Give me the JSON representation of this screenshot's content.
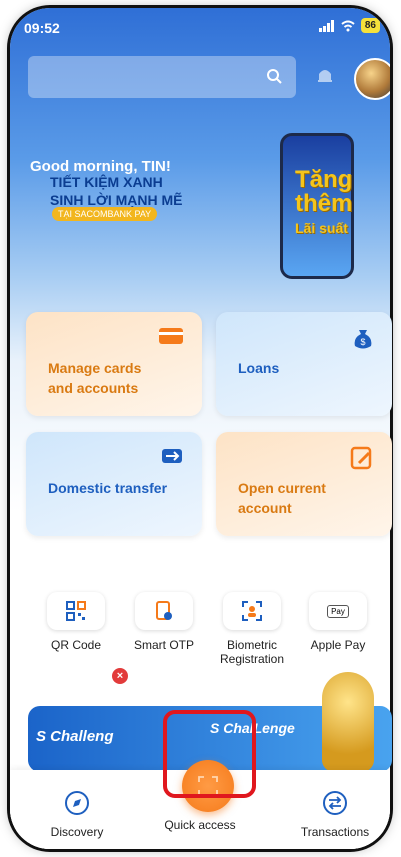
{
  "status": {
    "time": "09:52",
    "battery": "86"
  },
  "greeting": "Good morning, TIN!",
  "promo": {
    "line1": "TIẾT KIỆM XANH",
    "line2": "SINH LỜI MẠNH MẼ",
    "tag": "TẠI SACOMBANK PAY",
    "big1": "Tăng",
    "big2": "thêm",
    "big3": "Lãi suất"
  },
  "cards": {
    "manage": "Manage cards and accounts",
    "loans": "Loans",
    "domestic": "Domestic transfer",
    "open": "Open current account"
  },
  "quick": {
    "qr": "QR Code",
    "otp": "Smart OTP",
    "bio": "Biometric Registration",
    "apple": "Apple Pay",
    "apple_icon_text": "Pay"
  },
  "banner": {
    "left": "S Challeng",
    "right": "S ChalLenge"
  },
  "nav": {
    "discovery": "Discovery",
    "quick_access": "Quick access",
    "transactions": "Transactions"
  },
  "colors": {
    "accent_orange": "#f57a1a",
    "highlight_red": "#e0171e",
    "primary_blue": "#1e5fbf"
  }
}
